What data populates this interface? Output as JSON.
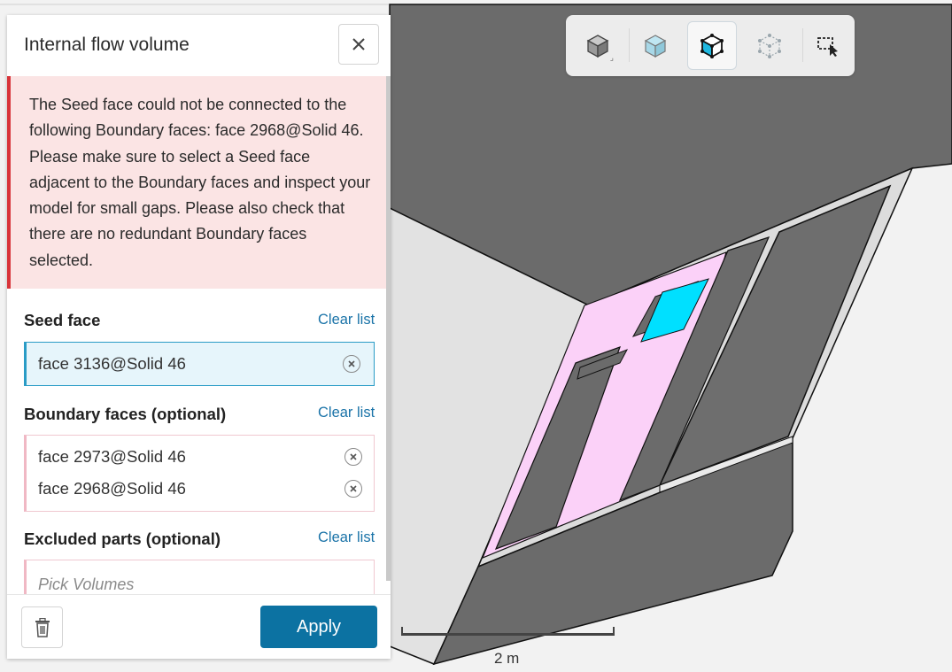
{
  "panel": {
    "title": "Internal flow volume",
    "error_message": "The Seed face could not be connected to the following Boundary faces: face 2968@Solid 46. Please make sure to select a Seed face adjacent to the Boundary faces and inspect your model for small gaps. Please also check that there are no redundant Boundary faces selected.",
    "seed_face": {
      "label": "Seed face",
      "clear_label": "Clear list",
      "items": [
        "face 3136@Solid 46"
      ]
    },
    "boundary_faces": {
      "label": "Boundary faces (optional)",
      "clear_label": "Clear list",
      "items": [
        "face 2973@Solid 46",
        "face 2968@Solid 46"
      ]
    },
    "excluded_parts": {
      "label": "Excluded parts (optional)",
      "clear_label": "Clear list",
      "placeholder": "Pick Volumes"
    },
    "apply_label": "Apply"
  },
  "toolbar": {
    "buttons": [
      {
        "icon": "solid-cube-icon",
        "active": false
      },
      {
        "icon": "transparent-cube-icon",
        "active": false
      },
      {
        "icon": "face-select-cube-icon",
        "active": true
      },
      {
        "icon": "wireframe-cube-icon",
        "active": false
      },
      {
        "icon": "box-select-icon",
        "active": false
      }
    ]
  },
  "viewport": {
    "scale_label": "2 m",
    "colors": {
      "body_dark": "#6b6b6b",
      "face_light": "#e2e2e2",
      "boundary_pink": "#fbd1f8",
      "seed_cyan": "#00e0ff"
    }
  }
}
